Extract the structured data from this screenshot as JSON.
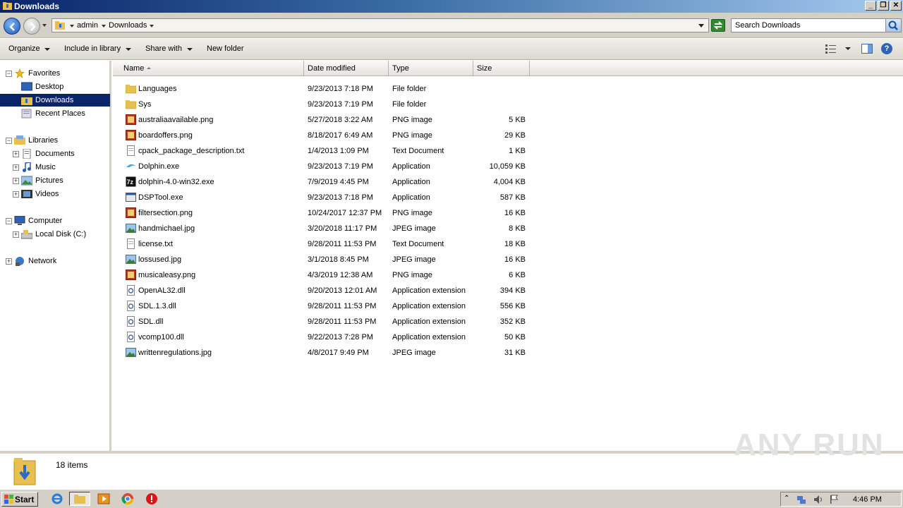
{
  "window": {
    "title": "Downloads"
  },
  "address": {
    "crumbs": [
      "admin",
      "Downloads"
    ],
    "search_placeholder": "Search Downloads"
  },
  "toolbar": {
    "organize": "Organize",
    "include_in_library": "Include in library",
    "share_with": "Share with",
    "new_folder": "New folder"
  },
  "nav": {
    "favorites": "Favorites",
    "desktop": "Desktop",
    "downloads": "Downloads",
    "recent_places": "Recent Places",
    "libraries": "Libraries",
    "documents": "Documents",
    "music": "Music",
    "pictures": "Pictures",
    "videos": "Videos",
    "computer": "Computer",
    "local_disk": "Local Disk (C:)",
    "network": "Network"
  },
  "columns": {
    "name": "Name",
    "date": "Date modified",
    "type": "Type",
    "size": "Size"
  },
  "files": [
    {
      "name": "Languages",
      "date": "9/23/2013 7:18 PM",
      "type": "File folder",
      "size": "",
      "icon": "folder"
    },
    {
      "name": "Sys",
      "date": "9/23/2013 7:19 PM",
      "type": "File folder",
      "size": "",
      "icon": "folder"
    },
    {
      "name": "australiaavailable.png",
      "date": "5/27/2018 3:22 AM",
      "type": "PNG image",
      "size": "5 KB",
      "icon": "png"
    },
    {
      "name": "boardoffers.png",
      "date": "8/18/2017 6:49 AM",
      "type": "PNG image",
      "size": "29 KB",
      "icon": "png"
    },
    {
      "name": "cpack_package_description.txt",
      "date": "1/4/2013 1:09 PM",
      "type": "Text Document",
      "size": "1 KB",
      "icon": "txt"
    },
    {
      "name": "Dolphin.exe",
      "date": "9/23/2013 7:19 PM",
      "type": "Application",
      "size": "10,059 KB",
      "icon": "dolphin"
    },
    {
      "name": "dolphin-4.0-win32.exe",
      "date": "7/9/2019 4:45 PM",
      "type": "Application",
      "size": "4,004 KB",
      "icon": "7z"
    },
    {
      "name": "DSPTool.exe",
      "date": "9/23/2013 7:18 PM",
      "type": "Application",
      "size": "587 KB",
      "icon": "exe"
    },
    {
      "name": "filtersection.png",
      "date": "10/24/2017 12:37 PM",
      "type": "PNG image",
      "size": "16 KB",
      "icon": "png"
    },
    {
      "name": "handmichael.jpg",
      "date": "3/20/2018 11:17 PM",
      "type": "JPEG image",
      "size": "8 KB",
      "icon": "jpg"
    },
    {
      "name": "license.txt",
      "date": "9/28/2011 11:53 PM",
      "type": "Text Document",
      "size": "18 KB",
      "icon": "txt"
    },
    {
      "name": "lossused.jpg",
      "date": "3/1/2018 8:45 PM",
      "type": "JPEG image",
      "size": "16 KB",
      "icon": "jpg"
    },
    {
      "name": "musicaleasy.png",
      "date": "4/3/2019 12:38 AM",
      "type": "PNG image",
      "size": "6 KB",
      "icon": "png"
    },
    {
      "name": "OpenAL32.dll",
      "date": "9/20/2013 12:01 AM",
      "type": "Application extension",
      "size": "394 KB",
      "icon": "dll"
    },
    {
      "name": "SDL.1.3.dll",
      "date": "9/28/2011 11:53 PM",
      "type": "Application extension",
      "size": "556 KB",
      "icon": "dll"
    },
    {
      "name": "SDL.dll",
      "date": "9/28/2011 11:53 PM",
      "type": "Application extension",
      "size": "352 KB",
      "icon": "dll"
    },
    {
      "name": "vcomp100.dll",
      "date": "9/22/2013 7:28 PM",
      "type": "Application extension",
      "size": "50 KB",
      "icon": "dll"
    },
    {
      "name": "writtenregulations.jpg",
      "date": "4/8/2017 9:49 PM",
      "type": "JPEG image",
      "size": "31 KB",
      "icon": "jpg"
    }
  ],
  "details": {
    "count": "18 items"
  },
  "watermark": "ANY RUN",
  "taskbar": {
    "start": "Start",
    "clock": "4:46 PM"
  }
}
